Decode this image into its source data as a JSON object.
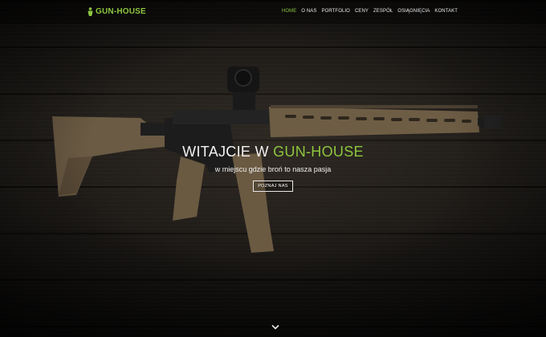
{
  "brand": {
    "name": "GUN-HOUSE",
    "accent_color": "#8dc63f",
    "icon": "soldier-icon"
  },
  "nav": {
    "items": [
      {
        "label": "HOME",
        "active": true
      },
      {
        "label": "O NAS",
        "active": false
      },
      {
        "label": "PORTFOLIO",
        "active": false
      },
      {
        "label": "CENY",
        "active": false
      },
      {
        "label": "ZESPÓŁ",
        "active": false
      },
      {
        "label": "OSIĄGNIĘCIA",
        "active": false
      },
      {
        "label": "KONTAKT",
        "active": false
      }
    ]
  },
  "hero": {
    "title_prefix": "WITAJCIE W ",
    "title_accent": "GUN-HOUSE",
    "subtitle": "w miejscu gdzie broń to nasza pasja",
    "button_label": "POZNAJ NAS",
    "background": "rifle-on-dark-wood",
    "scroll_icon": "chevron-down-icon"
  }
}
